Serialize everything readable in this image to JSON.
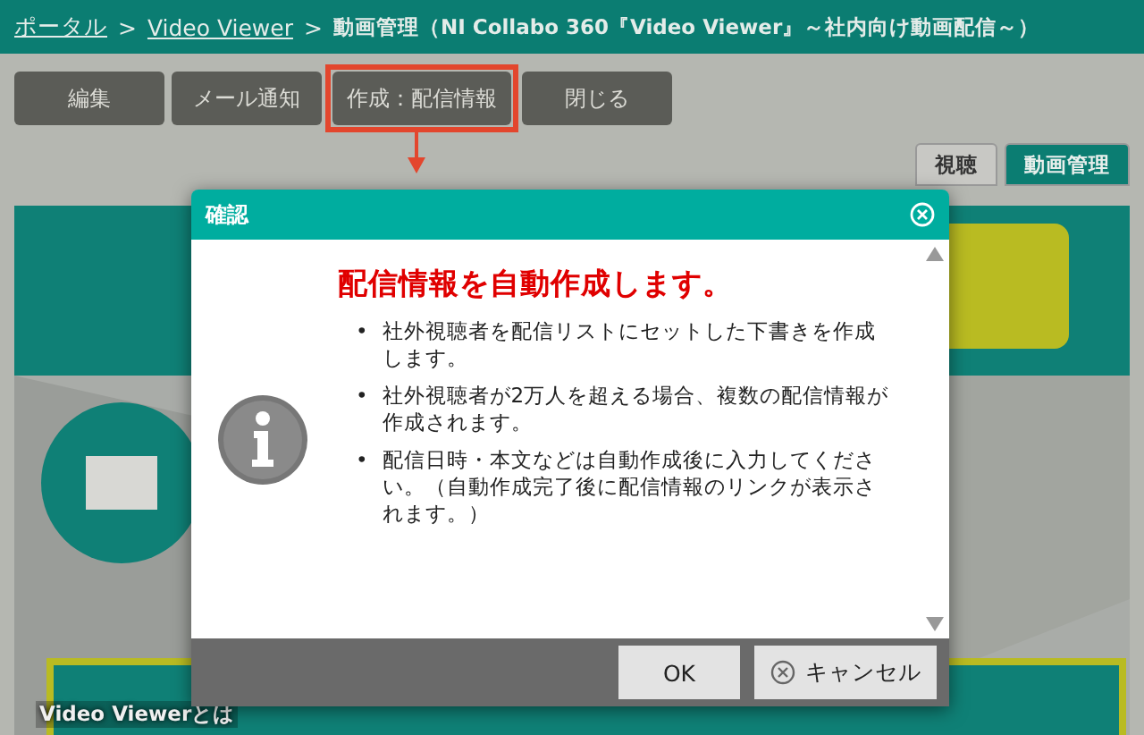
{
  "breadcrumb": [
    {
      "label": "ポータル",
      "link": true
    },
    {
      "label": "Video Viewer",
      "link": true
    },
    {
      "label": "動画管理（NI Collabo 360『Video Viewer』～社内向け動画配信～）",
      "link": false
    }
  ],
  "breadcrumb_separator": ">",
  "toolbar": [
    {
      "label": "編集",
      "highlighted": false
    },
    {
      "label": "メール通知",
      "highlighted": false
    },
    {
      "label": "作成：配信情報",
      "highlighted": true
    },
    {
      "label": "閉じる",
      "highlighted": false
    }
  ],
  "view_tabs": [
    {
      "label": "視聴",
      "selected": false
    },
    {
      "label": "動画管理",
      "selected": true
    }
  ],
  "video": {
    "caption": "Video Viewerとは"
  },
  "bullet_marker": "•",
  "dialog": {
    "title": "確認",
    "heading": "配信情報を自動作成します。",
    "bullets": [
      "社外視聴者を配信リストにセットした下書きを作成します。",
      "社外視聴者が2万人を超える場合、複数の配信情報が作成されます。",
      "配信日時・本文などは自動作成後に入力してください。（自動作成完了後に配信情報のリンクが表示されます。）"
    ],
    "buttons": [
      {
        "label": "OK",
        "kind": "ok"
      },
      {
        "label": "キャンセル",
        "kind": "cancel"
      }
    ]
  }
}
